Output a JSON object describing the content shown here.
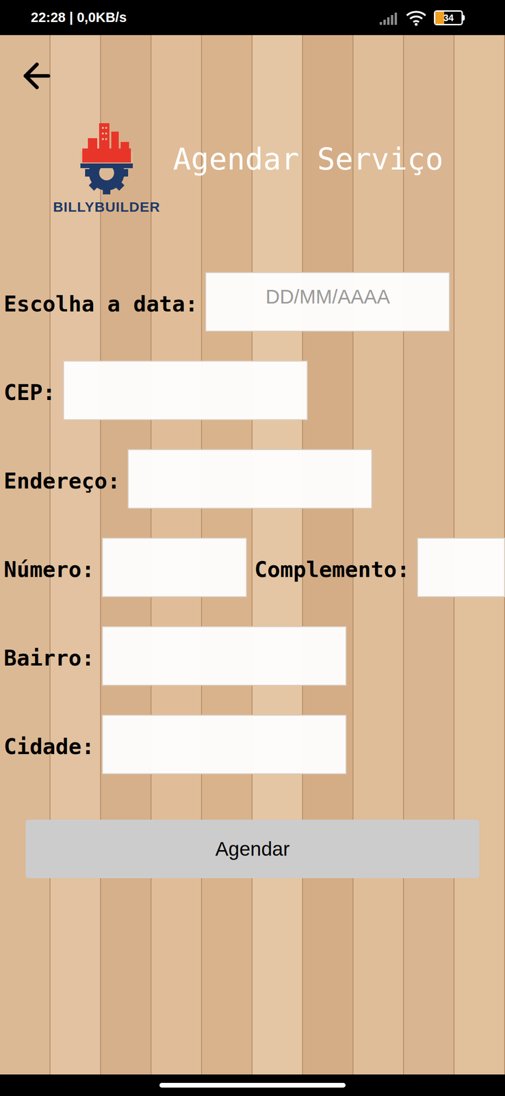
{
  "status_bar": {
    "time": "22:28 | 0,0KB/s",
    "battery": "34",
    "battery_level": 0.34
  },
  "header": {
    "title": "Agendar Serviço",
    "logo_text": "BILLYBUILDER"
  },
  "form": {
    "rows": [
      {
        "fields": [
          {
            "label": "Escolha a data:",
            "placeholder": "DD/MM/AAAA",
            "value": "",
            "size": "wide"
          }
        ]
      },
      {
        "fields": [
          {
            "label": "CEP:",
            "placeholder": "",
            "value": "",
            "size": "wide"
          }
        ]
      },
      {
        "fields": [
          {
            "label": "Endereço:",
            "placeholder": "",
            "value": "",
            "size": "wide"
          }
        ]
      },
      {
        "fields": [
          {
            "label": "Número:",
            "placeholder": "",
            "value": "",
            "size": "short"
          },
          {
            "label": "Complemento:",
            "placeholder": "",
            "value": "",
            "size": "fill"
          }
        ]
      },
      {
        "fields": [
          {
            "label": "Bairro:",
            "placeholder": "",
            "value": "",
            "size": "wide"
          }
        ]
      },
      {
        "fields": [
          {
            "label": "Cidade:",
            "placeholder": "",
            "value": "",
            "size": "wide"
          }
        ]
      }
    ]
  },
  "button": {
    "label": "Agendar"
  }
}
